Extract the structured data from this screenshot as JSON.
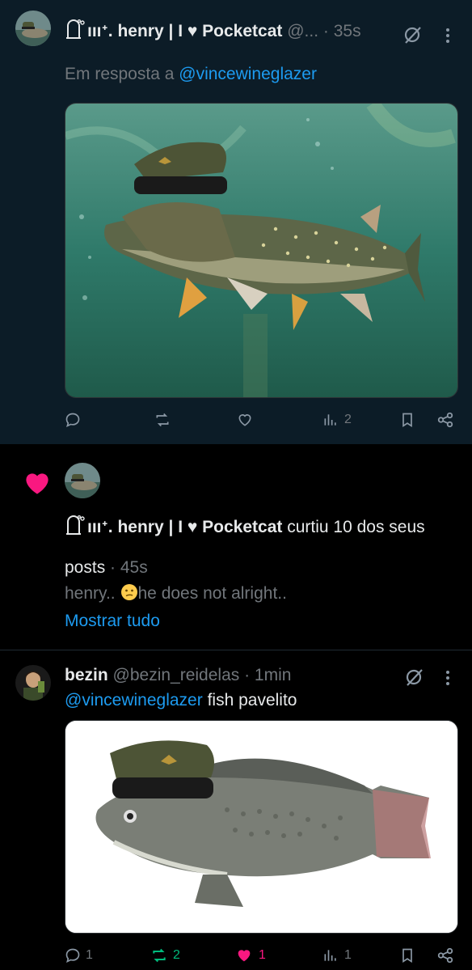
{
  "tweet1": {
    "display_name": "ıııᐩ. henry | I ♥ Pocketcat",
    "handle": "@...",
    "time": "· 35s",
    "reply_prefix": "Em resposta a",
    "reply_to": "@vincewineglazer",
    "image_alt": "pike fish wearing military cap",
    "stats": {
      "views": "2"
    },
    "icons": [
      "reply-icon",
      "retweet-icon",
      "like-icon",
      "views-icon",
      "bookmark-icon",
      "share-icon",
      "grok-icon",
      "more-icon"
    ]
  },
  "notification": {
    "display_name": "ıııᐩ. henry | I ♥ Pocketcat",
    "action_text": "curtiu 10 dos seus",
    "action_text_cont": "posts",
    "time": "· 45s",
    "preview": "henry.. 😕he does not alright..",
    "preview_before": "henry..",
    "preview_after": "he does not alright..",
    "show_all": "Mostrar tudo",
    "heart_color": "#f91880"
  },
  "tweet2": {
    "display_name": "bezin",
    "handle": "@bezin_reidelas",
    "time": "· 1min",
    "mention": "@vincewineglazer",
    "text": "fish pavelito",
    "image_alt": "tilapia fish wearing military cap",
    "stats": {
      "replies": "1",
      "retweets": "2",
      "likes": "1",
      "views": "1"
    },
    "retweet_color": "#00ba7c",
    "like_color": "#f91880"
  },
  "colors": {
    "accent": "#1d9bf0",
    "muted": "#71767b",
    "bg_highlight": "#0c1c27"
  }
}
